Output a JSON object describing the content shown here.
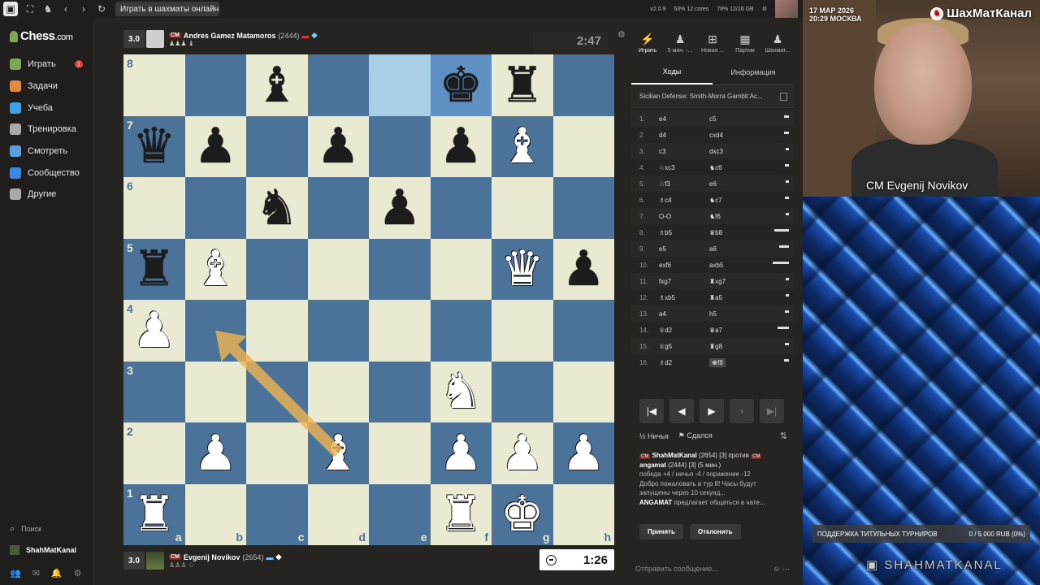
{
  "browser": {
    "tab_title": "Играть в шахматы онлайн ...",
    "status": {
      "version": "v2.0.9",
      "cpu": "53% 12 cores",
      "mem": "78% 12/16 GB"
    }
  },
  "sidebar": {
    "logo": "Chess",
    "logo_suffix": ".com",
    "items": [
      {
        "label": "Играть",
        "icon": "play-icon",
        "color": "#7fa650",
        "badge": "1"
      },
      {
        "label": "Задачи",
        "icon": "puzzle-icon",
        "color": "#e58a3a"
      },
      {
        "label": "Учеба",
        "icon": "learn-icon",
        "color": "#3aa3e5"
      },
      {
        "label": "Тренировка",
        "icon": "practice-icon",
        "color": "#aaa"
      },
      {
        "label": "Смотреть",
        "icon": "watch-icon",
        "color": "#5aa0e0"
      },
      {
        "label": "Сообщество",
        "icon": "community-icon",
        "color": "#3a8ae5"
      },
      {
        "label": "Другие",
        "icon": "more-icon",
        "color": "#aaa"
      }
    ],
    "search_label": "Поиск",
    "user_label": "ShahMatKanal"
  },
  "top_player": {
    "rating_pill": "3.0",
    "title": "CM",
    "name": "Andres Gamez Matamoros",
    "rating": "(2444)",
    "captured": "♟♟♟ ♝",
    "clock": "2:47"
  },
  "bottom_player": {
    "rating_pill": "3.0",
    "title": "CM",
    "name": "Evgenij Novikov",
    "rating": "(2654)",
    "captured": "♙♙♙ ♘",
    "clock": "1:26"
  },
  "board": {
    "ranks": [
      "8",
      "7",
      "6",
      "5",
      "4",
      "3",
      "2",
      "1"
    ],
    "files": [
      "a",
      "b",
      "c",
      "d",
      "e",
      "f",
      "g",
      "h"
    ],
    "highlight": [
      "e8",
      "f8"
    ],
    "pieces": {
      "c8": "b-b",
      "f8": "b-k",
      "g8": "b-r",
      "a7": "b-q",
      "b7": "b-p",
      "d7": "b-p",
      "f7": "b-p",
      "g7": "w-b",
      "c6": "b-n",
      "e6": "b-p",
      "a5": "b-r",
      "b5": "w-b",
      "g5": "w-q",
      "h5": "b-p",
      "a4": "w-p",
      "f3": "w-n",
      "b2": "w-p",
      "d2": "w-b",
      "f2": "w-p",
      "g2": "w-p",
      "h2": "w-p",
      "a1": "w-r",
      "f1": "w-r",
      "g1": "w-k"
    },
    "arrow": {
      "from": "d2",
      "to": "b4",
      "color": "#f0b450"
    }
  },
  "panel": {
    "tabs": [
      {
        "label": "Играть",
        "icon": "lightning-icon"
      },
      {
        "label": "5 мин. -...",
        "icon": "pawn-icon"
      },
      {
        "label": "Новая ...",
        "icon": "plus-icon"
      },
      {
        "label": "Партии",
        "icon": "grid-icon"
      },
      {
        "label": "Шахмат...",
        "icon": "players-icon"
      }
    ],
    "sub_tabs": [
      "Ходы",
      "Информация"
    ],
    "opening": "Sicilian Defense: Smith-Morra Gambit Ac...",
    "moves": [
      {
        "n": "1.",
        "w": "e4",
        "b": "c5",
        "bar": 6
      },
      {
        "n": "2.",
        "w": "d4",
        "b": "cxd4",
        "bar": 6
      },
      {
        "n": "3.",
        "w": "c3",
        "b": "dxc3",
        "bar": 4
      },
      {
        "n": "4.",
        "w": "♘xc3",
        "b": "♞c6",
        "bar": 5
      },
      {
        "n": "5.",
        "w": "♘f3",
        "b": "e6",
        "bar": 4
      },
      {
        "n": "6.",
        "w": "♗c4",
        "b": "♞c7",
        "bar": 5
      },
      {
        "n": "7.",
        "w": "O-O",
        "b": "♞f6",
        "bar": 4
      },
      {
        "n": "8.",
        "w": "♗b5",
        "b": "♛b8",
        "bar": 18
      },
      {
        "n": "9.",
        "w": "e5",
        "b": "a6",
        "bar": 12
      },
      {
        "n": "10.",
        "w": "exf6",
        "b": "axb5",
        "bar": 20
      },
      {
        "n": "11.",
        "w": "fxg7",
        "b": "♜xg7",
        "bar": 4
      },
      {
        "n": "12.",
        "w": "♗xb5",
        "b": "♜a5",
        "bar": 4
      },
      {
        "n": "13.",
        "w": "a4",
        "b": "h5",
        "bar": 5
      },
      {
        "n": "14.",
        "w": "♕d2",
        "b": "♛a7",
        "bar": 14
      },
      {
        "n": "15.",
        "w": "♕g5",
        "b": "♜g8",
        "bar": 5
      },
      {
        "n": "16.",
        "w": "♗d2",
        "b": "♚f8",
        "bar": 6
      }
    ],
    "draw_label": "Ничья",
    "resign_label": "Сдался",
    "chat": {
      "player1": "ShahMatKanal",
      "p1_rating": "(2654) [3]",
      "vs": "против",
      "player2": "angamat",
      "p2_rating": "(2444) [3] (5 мин.)",
      "record": "победа +4 / ничья -4 / поражение -12",
      "welcome": "Добро пожаловать в тур 8! Часы будут запущены через 10 секунд...",
      "offer_name": "ANGAMAT",
      "offer_text": "предлагает общаться в чате..."
    },
    "accept_label": "Принять",
    "decline_label": "Отклонить",
    "message_placeholder": "Отправить сообщение..."
  },
  "stream": {
    "date": "17 МАР 2026",
    "time_city": "20:29 МОСКВА",
    "brand": "ШахМатКанал",
    "cam_name": "CM Evgenij Novikov",
    "support_label": "ПОДДЕРЖКА ТИТУЛЬНЫХ ТУРНИРОВ",
    "support_value": "0 / 5 000 RUB (0%)",
    "twitch": "SHAHMATKANAL"
  }
}
